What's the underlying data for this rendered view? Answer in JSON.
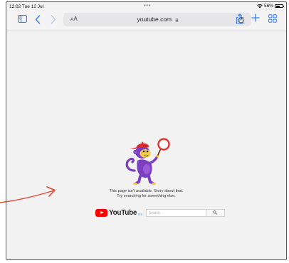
{
  "status_bar": {
    "time": "12:02  Tue 12 Jul",
    "dots": "•••",
    "battery_text": "56%",
    "battery_level": 0.56
  },
  "toolbar": {
    "reader_label_big": "A",
    "reader_label_small": "A",
    "url": "youtube.com",
    "icons": {
      "sidebar": "sidebar-icon",
      "back": "chevron-left-icon",
      "forward": "chevron-right-icon",
      "lock": "lock-icon",
      "reload": "reload-icon",
      "share": "share-icon",
      "new_tab": "plus-icon",
      "tabs": "tabs-grid-icon"
    }
  },
  "content": {
    "message_line1": "This page isn't available. Sorry about that.",
    "message_line2": "Try searching for something else.",
    "logo_word": "YouTube",
    "logo_country": "GB",
    "search_placeholder": "Search"
  },
  "colors": {
    "accent_blue": "#2f7bf6",
    "youtube_red": "#ff0000",
    "annotation_arrow": "#e0452f",
    "monkey_purple": "#7b3fbf"
  }
}
